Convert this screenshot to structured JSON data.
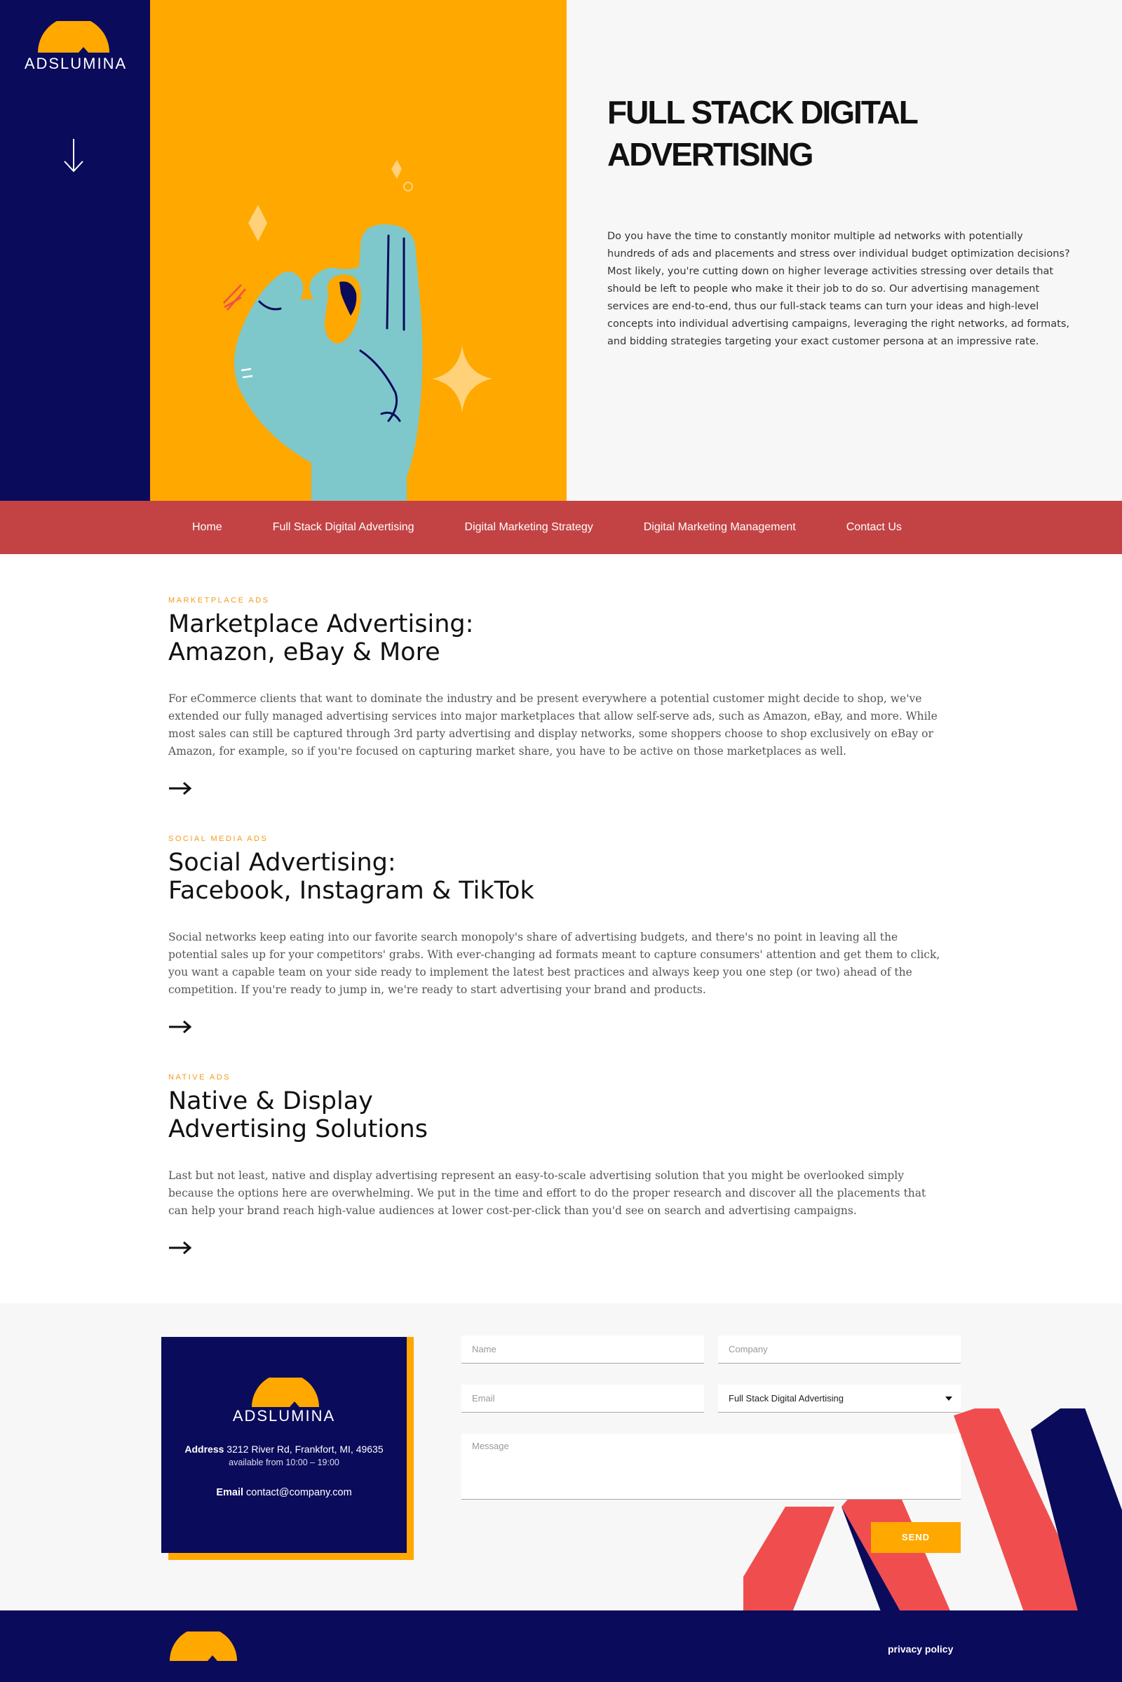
{
  "brand": {
    "name": "ADSLUMINA",
    "colors": {
      "navy": "#0b0b5c",
      "yellow": "#ffa800",
      "red": "#c34345",
      "coral": "#f04e4e",
      "kicker": "#f59a1b"
    }
  },
  "hero": {
    "title": "FULL STACK DIGITAL ADVERTISING",
    "text": "Do you have the time to constantly monitor multiple ad networks with potentially hundreds of ads and placements and stress over individual budget optimization decisions? Most likely, you're cutting down on higher leverage activities stressing over details that should be left to people who make it their job to do so. Our advertising management services are end-to-end, thus our full-stack teams can turn your ideas and high-level concepts into individual advertising campaigns, leveraging the right networks, ad formats, and bidding strategies targeting your exact customer persona at an impressive rate.",
    "scroll_icon": "arrow-down-icon",
    "illustration": "ok-hand-gesture"
  },
  "nav": {
    "items": [
      {
        "label": "Home"
      },
      {
        "label": "Full Stack Digital Advertising"
      },
      {
        "label": "Digital Marketing Strategy"
      },
      {
        "label": "Digital Marketing Management"
      },
      {
        "label": "Contact Us"
      }
    ]
  },
  "services": [
    {
      "kicker": "MARKETPLACE ADS",
      "title_line1": "Marketplace Advertising:",
      "title_line2": "Amazon, eBay & More",
      "text": "For eCommerce clients that want to dominate the industry and be present everywhere a potential customer might decide to shop, we've extended our fully managed advertising services into major marketplaces that allow self-serve ads, such as Amazon, eBay, and more. While most sales can still be captured through 3rd party advertising and display networks, some shoppers choose to shop exclusively on eBay or Amazon, for example, so if you're focused on capturing market share, you have to be active on those marketplaces as well."
    },
    {
      "kicker": "SOCIAL MEDIA ADS",
      "title_line1": "Social Advertising:",
      "title_line2": "Facebook, Instagram & TikTok",
      "text": "Social networks keep eating into our favorite search monopoly's share of advertising budgets, and there's no point in leaving all the potential sales up for your competitors' grabs. With ever-changing ad formats meant to capture consumers' attention and get them to click, you want a capable team on your side ready to implement the latest best practices and always keep you one step (or two) ahead of the competition. If you're ready to jump in, we're ready to start advertising your brand and products."
    },
    {
      "kicker": "NATIVE ADS",
      "title_line1": "Native & Display",
      "title_line2": "Advertising Solutions",
      "text": "Last but not least, native and display advertising represent an easy-to-scale advertising solution that you might be overlooked simply because the options here are overwhelming. We put in the time and effort to do the proper research and discover all the placements that can help your brand reach high-value audiences at lower cost-per-click than you'd see on search and advertising campaigns."
    }
  ],
  "contact": {
    "card": {
      "brand": "ADSLUMINA",
      "address_label": "Address",
      "address": "3212 River Rd, Frankfort, MI, 49635",
      "hours": "available from 10:00 – 19:00",
      "email_label": "Email",
      "email": "contact@company.com"
    },
    "form": {
      "name_placeholder": "Name",
      "company_placeholder": "Company",
      "email_placeholder": "Email",
      "service_selected": "Full Stack Digital Advertising",
      "message_placeholder": "Message",
      "send_label": "SEND"
    }
  },
  "footer": {
    "privacy_label": "privacy policy"
  }
}
